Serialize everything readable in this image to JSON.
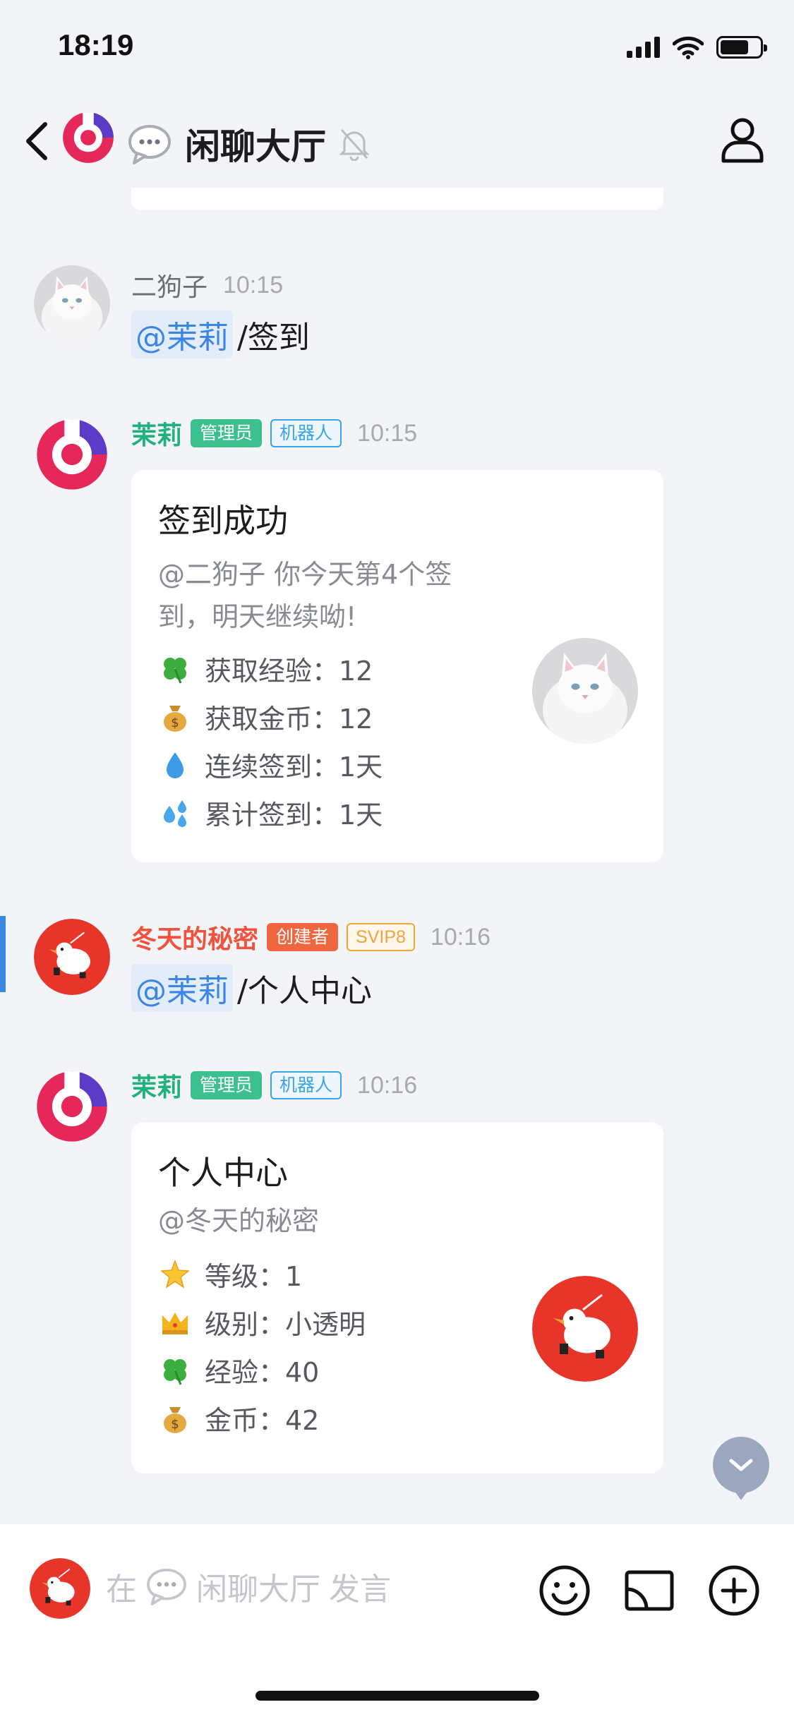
{
  "status_bar": {
    "time": "18:19"
  },
  "nav": {
    "title": "闲聊大厅"
  },
  "messages": [
    {
      "sender": "二狗子",
      "time": "10:15",
      "mention": "@茉莉",
      "text": "/签到"
    },
    {
      "sender": "茉莉",
      "badges": [
        "管理员",
        "机器人"
      ],
      "time": "10:15",
      "card": {
        "title": "签到成功",
        "subtitle": "@二狗子 你今天第4个签到，明天继续呦!",
        "rows": [
          {
            "icon": "clover-icon",
            "text": "获取经验：12"
          },
          {
            "icon": "money-bag-icon",
            "text": "获取金币：12"
          },
          {
            "icon": "droplet-icon",
            "text": "连续签到：1天"
          },
          {
            "icon": "sweat-drops-icon",
            "text": "累计签到：1天"
          }
        ]
      }
    },
    {
      "sender": "冬天的秘密",
      "badges": [
        "创建者",
        "SVIP8"
      ],
      "time": "10:16",
      "mention": "@茉莉",
      "text": "/个人中心"
    },
    {
      "sender": "茉莉",
      "badges": [
        "管理员",
        "机器人"
      ],
      "time": "10:16",
      "card": {
        "title": "个人中心",
        "subtitle": "@冬天的秘密",
        "rows": [
          {
            "icon": "star-icon",
            "text": "等级：1"
          },
          {
            "icon": "crown-icon",
            "text": "级别：小透明"
          },
          {
            "icon": "clover-icon",
            "text": "经验：40"
          },
          {
            "icon": "money-bag-icon",
            "text": "金币：42"
          }
        ]
      }
    }
  ],
  "input": {
    "prefix": "在",
    "room": "闲聊大厅",
    "suffix": "发言"
  },
  "colors": {
    "accent_blue": "#3b86e3",
    "admin_green": "#22b07d",
    "creator_red": "#f0533b"
  }
}
